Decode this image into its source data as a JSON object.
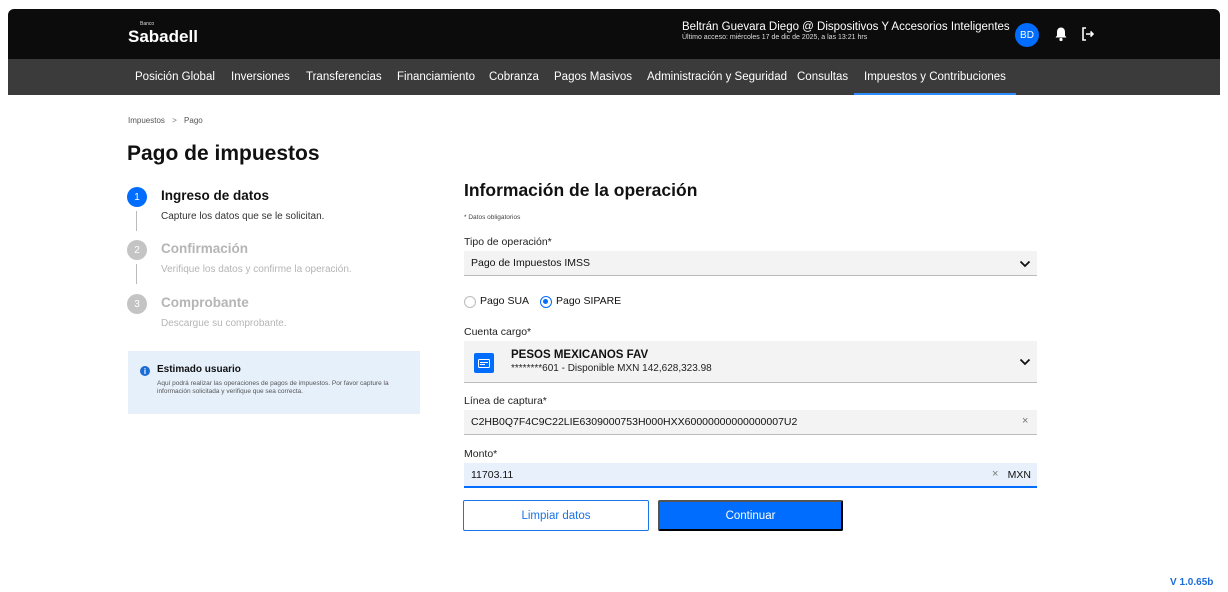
{
  "header": {
    "logo_small": "Banco",
    "logo_main": "Sabadell",
    "user_name": "Beltrán Guevara Diego @ Dispositivos Y Accesorios Inteligentes",
    "last_access": "Último acceso: miércoles 17 de dic de 2025, a las 13:21 hrs",
    "avatar_initials": "BD"
  },
  "nav": {
    "items": [
      "Posición Global",
      "Inversiones",
      "Transferencias",
      "Financiamiento",
      "Cobranza",
      "Pagos Masivos",
      "Administración y Seguridad",
      "Consultas",
      "Impuestos y Contribuciones"
    ],
    "active": "Impuestos y Contribuciones"
  },
  "breadcrumb": {
    "items": [
      "Impuestos",
      "Pago"
    ],
    "separator": ">"
  },
  "page_title": "Pago de impuestos",
  "steps": [
    {
      "number": "1",
      "title": "Ingreso de datos",
      "description": "Capture los datos que se le solicitan.",
      "state": "active"
    },
    {
      "number": "2",
      "title": "Confirmación",
      "description": "Verifique los datos y confirme la operación.",
      "state": "inactive"
    },
    {
      "number": "3",
      "title": "Comprobante",
      "description": "Descargue su comprobante.",
      "state": "inactive"
    }
  ],
  "info_box": {
    "title": "Estimado usuario",
    "text": "Aquí podrá realizar las operaciones de pagos de impuestos. Por favor capture la información solicitada y verifique que sea correcta."
  },
  "form": {
    "section_title": "Información de la operación",
    "required_note": "* Datos obligatorios",
    "operation_type": {
      "label": "Tipo de operación*",
      "value": "Pago de Impuestos IMSS"
    },
    "payment_options": [
      {
        "label": "Pago SUA",
        "selected": false
      },
      {
        "label": "Pago SIPARE",
        "selected": true
      }
    ],
    "account": {
      "label": "Cuenta cargo*",
      "name": "PESOS MEXICANOS FAV",
      "detail": "********601 - Disponible MXN 142,628,323.98"
    },
    "capture_line": {
      "label": "Línea de captura*",
      "value": "C2HB0Q7F4C9C22LIE6309000753H000HXX60000000000000007U2"
    },
    "amount": {
      "label": "Monto*",
      "value": "11703.11",
      "currency": "MXN"
    },
    "clear_symbol": "×"
  },
  "buttons": {
    "clear": "Limpiar datos",
    "continue": "Continuar"
  },
  "version": "V 1.0.65b",
  "colors": {
    "accent": "#006dff",
    "header_bg": "#0c0c0c",
    "nav_bg": "#3b3b3b",
    "info_bg": "#e6f0fb"
  }
}
